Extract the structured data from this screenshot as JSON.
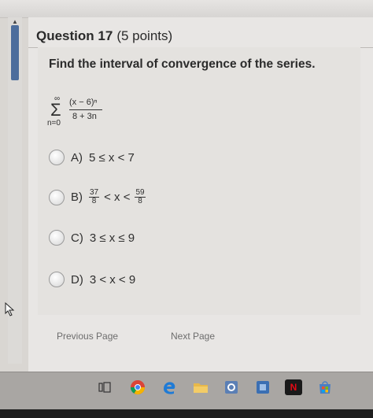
{
  "question": {
    "title": "Question 17",
    "points": "(5 points)",
    "prompt": "Find the interval of convergence of the series."
  },
  "series": {
    "upper": "∞",
    "sigma": "Σ",
    "lower": "n=0",
    "numerator": "(x − 6)ⁿ",
    "denominator": "8 + 3n"
  },
  "options": [
    {
      "letter": "A)",
      "text": "5 ≤ x < 7"
    },
    {
      "letter": "B)",
      "left_num": "37",
      "left_den": "8",
      "middle": "< x <",
      "right_num": "59",
      "right_den": "8"
    },
    {
      "letter": "C)",
      "text": "3 ≤ x ≤ 9"
    },
    {
      "letter": "D)",
      "text": "3 < x < 9"
    }
  ],
  "nav": {
    "previous": "Previous Page",
    "next": "Next Page"
  },
  "taskbar": {
    "icons": [
      "task-view-icon",
      "chrome-icon",
      "edge-icon",
      "file-explorer-icon",
      "settings-icon",
      "app-icon",
      "netflix-icon",
      "store-icon"
    ],
    "netflix_letter": "N"
  },
  "colors": {
    "scroll_thumb": "#4c6d9c",
    "page_bg": "#e8e6e4",
    "taskbar": "#a9a6a3"
  }
}
